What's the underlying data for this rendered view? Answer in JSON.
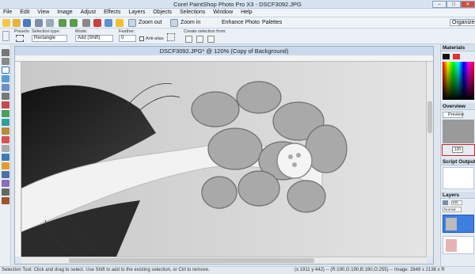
{
  "window": {
    "title": "Corel PaintShop Photo Pro X3 - DSCF3092.JPG"
  },
  "menu": [
    "File",
    "Edit",
    "View",
    "Image",
    "Adjust",
    "Effects",
    "Layers",
    "Objects",
    "Selections",
    "Window",
    "Help"
  ],
  "toolbar": {
    "zoom_out": "Zoom out",
    "zoom_in": "Zoom in",
    "enhance": "Enhance Photo",
    "palettes": "Palettes",
    "organizer": "Organizer"
  },
  "options": {
    "presets": "Presets:",
    "selection_type_label": "Selection type:",
    "selection_type_value": "Rectangle",
    "mode_label": "Mode:",
    "mode_value": "Add (Shift)",
    "feather_label": "Feather:",
    "feather_value": "0",
    "antialias": "Anti-alias",
    "create_from": "Create selection from:"
  },
  "document": {
    "title": "DSCF3092.JPG* @ 120% (Copy of Background)"
  },
  "panels": {
    "materials": "Materials",
    "overview": "Overview",
    "preview_tab": "Preview",
    "zoom_value": "120",
    "script_output": "Script Output",
    "layers": "Layers",
    "blend_mode": "Normal",
    "opacity": "100"
  },
  "status": {
    "hint": "Selection Tool: Click and drag to select. Use Shift to add to the existing selection, or Ctrl to remove.",
    "coords": "(x:1911 y:442) -- (R:190,G:190,B:190,O:255) -- Image:  2848 x 2136 x R"
  },
  "colors": {
    "accent": "#1f6fc5",
    "highlight_box": "#d62020"
  }
}
